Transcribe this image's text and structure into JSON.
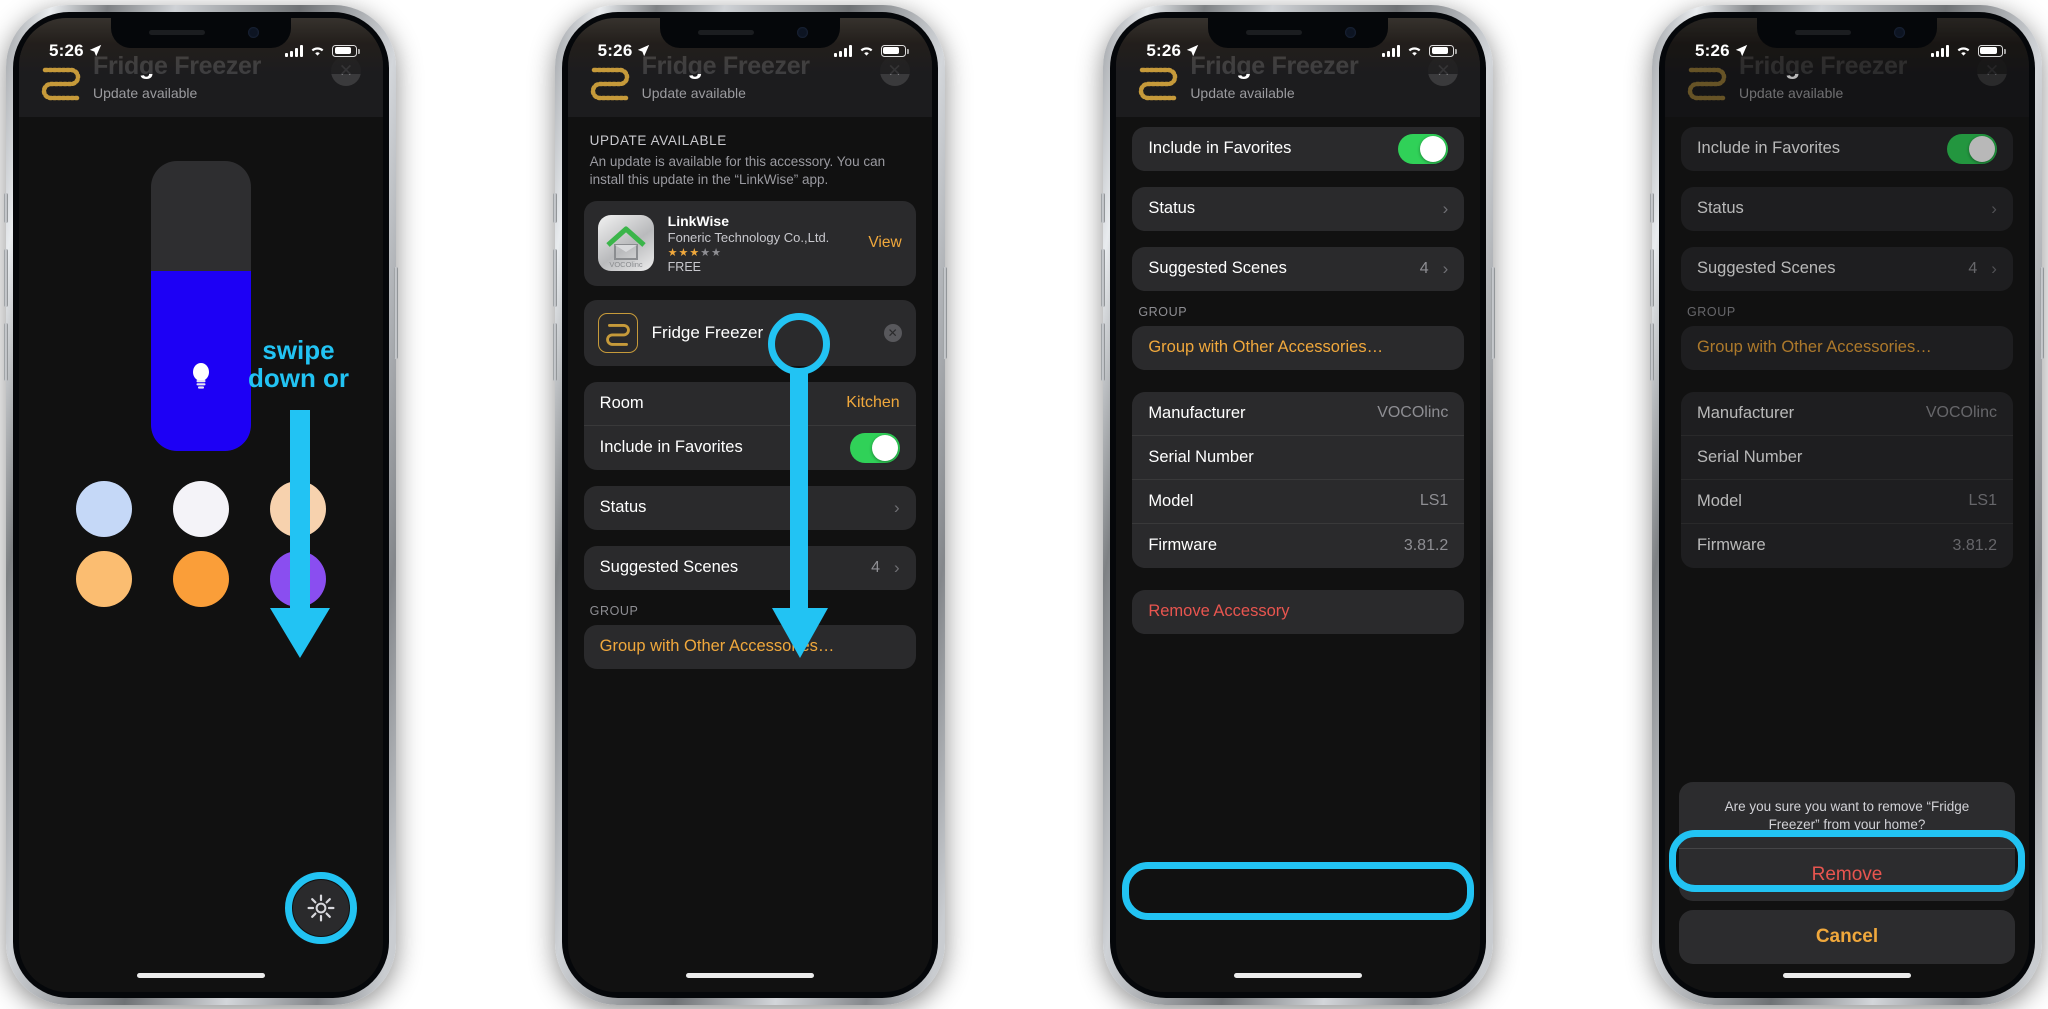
{
  "meta": {
    "accent_cyan": "#22c3f3",
    "accent_orange": "#f0a83c",
    "destructive_red": "#e8554f",
    "toggle_green": "#30d158"
  },
  "status_bar": {
    "time": "5:26",
    "location_icon": "location-arrow-icon"
  },
  "device": {
    "title": "Fridge Freezer",
    "subtitle": "Update available",
    "close_label": "✕"
  },
  "phone1": {
    "annotation": {
      "line1": "swipe",
      "line2": "down or"
    },
    "slider": {
      "fill_color": "#1d00f5",
      "level_percent": 62,
      "icon": "lightbulb-icon"
    },
    "swatches": [
      {
        "name": "swatch-pale-blue",
        "color": "#c5d8f7"
      },
      {
        "name": "swatch-white",
        "color": "#f4f3f8"
      },
      {
        "name": "swatch-peach",
        "color": "#f7d2ae"
      },
      {
        "name": "swatch-light-orange",
        "color": "#fbbd71"
      },
      {
        "name": "swatch-orange",
        "color": "#fa9e39"
      },
      {
        "name": "swatch-purple",
        "color": "#8a4ef0"
      }
    ],
    "gear_icon": "gear-icon"
  },
  "phone2": {
    "update_section_label": "UPDATE AVAILABLE",
    "update_description": "An update is available for this accessory. You can install this update in the “LinkWise” app.",
    "app": {
      "name": "LinkWise",
      "developer": "Foneric Technology Co.,Ltd.",
      "rating_filled": 3,
      "rating_total": 5,
      "price": "FREE",
      "view_label": "View",
      "icon_brand": "VOCOlinc"
    },
    "name_field": {
      "value": "Fridge Freezer",
      "clear_label": "✕"
    },
    "rows": [
      {
        "label": "Room",
        "value": "Kitchen",
        "type": "value-orange"
      },
      {
        "label": "Include in Favorites",
        "value": "on",
        "type": "toggle"
      }
    ],
    "rows2": [
      {
        "label": "Status",
        "value": "",
        "type": "chevron"
      }
    ],
    "rows3": [
      {
        "label": "Suggested Scenes",
        "value": "4",
        "type": "chevron"
      }
    ],
    "group_label": "GROUP",
    "group_action": "Group with Other Accessories…"
  },
  "phone3": {
    "rows_top": [
      {
        "label": "Include in Favorites",
        "type": "toggle",
        "value": "on"
      }
    ],
    "rows_status": [
      {
        "label": "Status",
        "type": "chevron",
        "value": ""
      }
    ],
    "rows_scenes": [
      {
        "label": "Suggested Scenes",
        "type": "chevron",
        "value": "4"
      }
    ],
    "group_label": "GROUP",
    "group_action": "Group with Other Accessories…",
    "info_rows": [
      {
        "label": "Manufacturer",
        "value": "VOCOlinc"
      },
      {
        "label": "Serial Number",
        "value": ""
      },
      {
        "label": "Model",
        "value": "LS1"
      },
      {
        "label": "Firmware",
        "value": "3.81.2"
      }
    ],
    "remove_label": "Remove Accessory"
  },
  "phone4": {
    "dialog": {
      "message": "Are you sure you want to remove “Fridge Freezer” from your home?",
      "confirm_label": "Remove",
      "cancel_label": "Cancel"
    }
  }
}
